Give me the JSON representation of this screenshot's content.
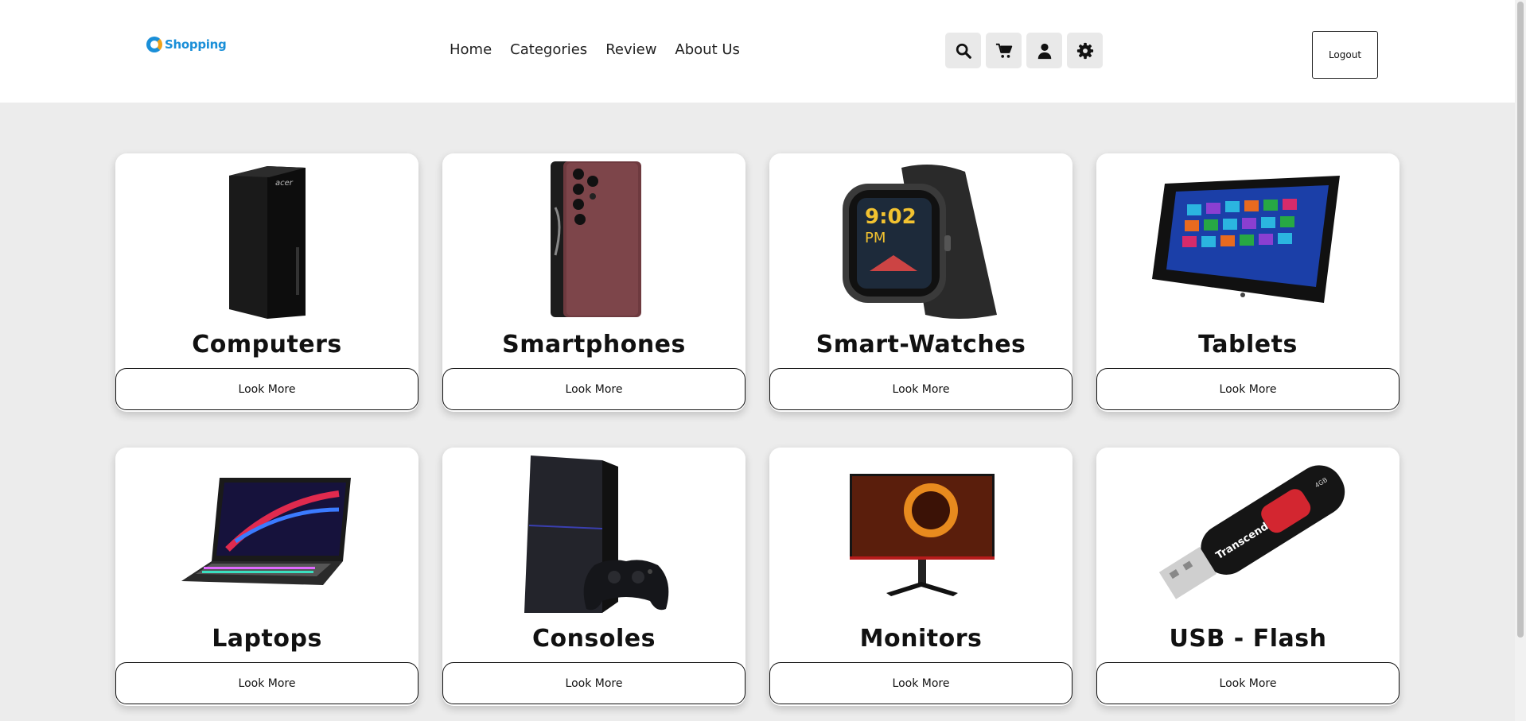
{
  "brand": {
    "name": "Shopping",
    "color": "#1a8fd8",
    "accent": "#f0a21a"
  },
  "nav": [
    {
      "label": "Home"
    },
    {
      "label": "Categories"
    },
    {
      "label": "Review"
    },
    {
      "label": "About Us"
    }
  ],
  "header_icons": [
    {
      "icon": "search-icon"
    },
    {
      "icon": "cart-icon"
    },
    {
      "icon": "user-icon"
    },
    {
      "icon": "gear-icon"
    }
  ],
  "logout_label": "Logout",
  "categories": [
    {
      "title": "Computers",
      "button": "Look More",
      "image": "desktop-tower-image"
    },
    {
      "title": "Smartphones",
      "button": "Look More",
      "image": "smartphone-image"
    },
    {
      "title": "Smart-Watches",
      "button": "Look More",
      "image": "smartwatch-image",
      "watch_time": "9:02",
      "watch_ampm": "PM"
    },
    {
      "title": "Tablets",
      "button": "Look More",
      "image": "tablet-image"
    },
    {
      "title": "Laptops",
      "button": "Look More",
      "image": "laptop-image"
    },
    {
      "title": "Consoles",
      "button": "Look More",
      "image": "console-image"
    },
    {
      "title": "Monitors",
      "button": "Look More",
      "image": "monitor-image"
    },
    {
      "title": "USB - Flash",
      "button": "Look More",
      "image": "usb-flash-image",
      "usb_brand": "Transcend",
      "usb_size": "4GB"
    }
  ]
}
